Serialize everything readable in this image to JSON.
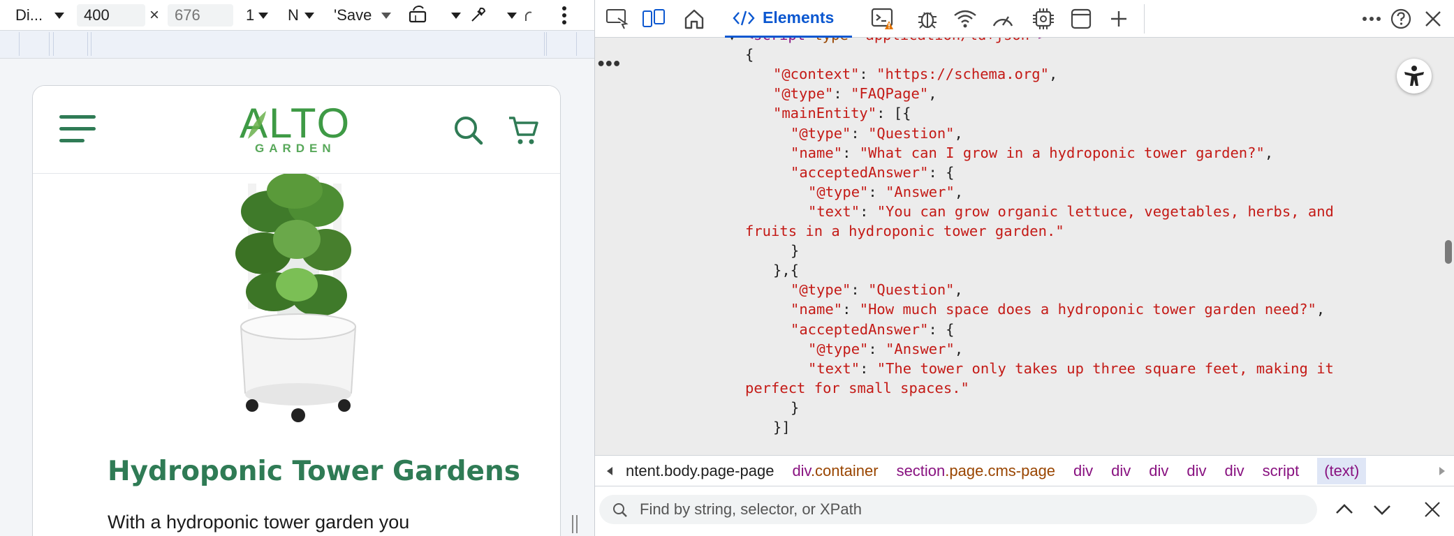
{
  "device_toolbar": {
    "device": "Di...",
    "width": "400",
    "times": "×",
    "height_placeholder": "676",
    "zoom": "1",
    "throttle": "N",
    "save": "'Save"
  },
  "site": {
    "logo_main": "ALTO",
    "logo_sub": "GARDEN",
    "heading": "Hydroponic Tower Gardens",
    "intro": "With a hydroponic tower garden you"
  },
  "devtools": {
    "active_tab": "Elements",
    "code_lines": [
      {
        "indent": 0,
        "segments": [
          {
            "t": "▼ ",
            "c": "punc"
          },
          {
            "t": "<script ",
            "c": "tag"
          },
          {
            "t": "type",
            "c": "attr"
          },
          {
            "t": "=\"",
            "c": "tag"
          },
          {
            "t": "application/ld+json",
            "c": "str"
          },
          {
            "t": "\">",
            "c": "tag"
          }
        ]
      },
      {
        "indent": 1,
        "segments": [
          {
            "t": "{",
            "c": "punc"
          }
        ]
      },
      {
        "indent": 2,
        "segments": [
          {
            "t": "\"@context\"",
            "c": "key"
          },
          {
            "t": ": ",
            "c": "punc"
          },
          {
            "t": "\"https://schema.org\"",
            "c": "str"
          },
          {
            "t": ",",
            "c": "punc"
          }
        ]
      },
      {
        "indent": 2,
        "segments": [
          {
            "t": "\"@type\"",
            "c": "key"
          },
          {
            "t": ": ",
            "c": "punc"
          },
          {
            "t": "\"FAQPage\"",
            "c": "str"
          },
          {
            "t": ",",
            "c": "punc"
          }
        ]
      },
      {
        "indent": 2,
        "segments": [
          {
            "t": "\"mainEntity\"",
            "c": "key"
          },
          {
            "t": ": [{",
            "c": "punc"
          }
        ]
      },
      {
        "indent": 3,
        "segments": [
          {
            "t": "\"@type\"",
            "c": "key"
          },
          {
            "t": ": ",
            "c": "punc"
          },
          {
            "t": "\"Question\"",
            "c": "str"
          },
          {
            "t": ",",
            "c": "punc"
          }
        ]
      },
      {
        "indent": 3,
        "segments": [
          {
            "t": "\"name\"",
            "c": "key"
          },
          {
            "t": ": ",
            "c": "punc"
          },
          {
            "t": "\"What can I grow in a hydroponic tower garden?\"",
            "c": "str"
          },
          {
            "t": ",",
            "c": "punc"
          }
        ]
      },
      {
        "indent": 3,
        "segments": [
          {
            "t": "\"acceptedAnswer\"",
            "c": "key"
          },
          {
            "t": ": {",
            "c": "punc"
          }
        ]
      },
      {
        "indent": 4,
        "segments": [
          {
            "t": "\"@type\"",
            "c": "key"
          },
          {
            "t": ": ",
            "c": "punc"
          },
          {
            "t": "\"Answer\"",
            "c": "str"
          },
          {
            "t": ",",
            "c": "punc"
          }
        ]
      },
      {
        "indent": 4,
        "segments": [
          {
            "t": "\"text\"",
            "c": "key"
          },
          {
            "t": ": ",
            "c": "punc"
          },
          {
            "t": "\"You can grow organic lettuce, vegetables, herbs, and",
            "c": "str"
          }
        ]
      },
      {
        "indent": 1,
        "segments": [
          {
            "t": "fruits in a hydroponic tower garden.\"",
            "c": "str"
          }
        ]
      },
      {
        "indent": 3,
        "segments": [
          {
            "t": "}",
            "c": "punc"
          }
        ]
      },
      {
        "indent": 2,
        "segments": [
          {
            "t": "},{",
            "c": "punc"
          }
        ]
      },
      {
        "indent": 3,
        "segments": [
          {
            "t": "\"@type\"",
            "c": "key"
          },
          {
            "t": ": ",
            "c": "punc"
          },
          {
            "t": "\"Question\"",
            "c": "str"
          },
          {
            "t": ",",
            "c": "punc"
          }
        ]
      },
      {
        "indent": 3,
        "segments": [
          {
            "t": "\"name\"",
            "c": "key"
          },
          {
            "t": ": ",
            "c": "punc"
          },
          {
            "t": "\"How much space does a hydroponic tower garden need?\"",
            "c": "str"
          },
          {
            "t": ",",
            "c": "punc"
          }
        ]
      },
      {
        "indent": 3,
        "segments": [
          {
            "t": "\"acceptedAnswer\"",
            "c": "key"
          },
          {
            "t": ": {",
            "c": "punc"
          }
        ]
      },
      {
        "indent": 4,
        "segments": [
          {
            "t": "\"@type\"",
            "c": "key"
          },
          {
            "t": ": ",
            "c": "punc"
          },
          {
            "t": "\"Answer\"",
            "c": "str"
          },
          {
            "t": ",",
            "c": "punc"
          }
        ]
      },
      {
        "indent": 4,
        "segments": [
          {
            "t": "\"text\"",
            "c": "key"
          },
          {
            "t": ": ",
            "c": "punc"
          },
          {
            "t": "\"The tower only takes up three square feet, making it",
            "c": "str"
          }
        ]
      },
      {
        "indent": 1,
        "segments": [
          {
            "t": "perfect for small spaces.\"",
            "c": "str"
          }
        ]
      },
      {
        "indent": 3,
        "segments": [
          {
            "t": "}",
            "c": "punc"
          }
        ]
      },
      {
        "indent": 2,
        "segments": [
          {
            "t": "}]",
            "c": "punc"
          }
        ]
      }
    ],
    "breadcrumbs": [
      {
        "tag": "ntent.body.page-page",
        "cls": ""
      },
      {
        "tag": "div",
        "cls": ".container"
      },
      {
        "tag": "section",
        "cls": ".page.cms-page"
      },
      {
        "tag": "div",
        "cls": ""
      },
      {
        "tag": "div",
        "cls": ""
      },
      {
        "tag": "div",
        "cls": ""
      },
      {
        "tag": "div",
        "cls": ""
      },
      {
        "tag": "div",
        "cls": ""
      },
      {
        "tag": "script",
        "cls": ""
      }
    ],
    "breadcrumb_selected": "(text)",
    "find_placeholder": "Find by string, selector, or XPath"
  },
  "colors": {
    "brand_green": "#2f7b55",
    "devtools_accent": "#0b57d0",
    "string_red": "#c41a16",
    "tag_purple": "#881280"
  }
}
